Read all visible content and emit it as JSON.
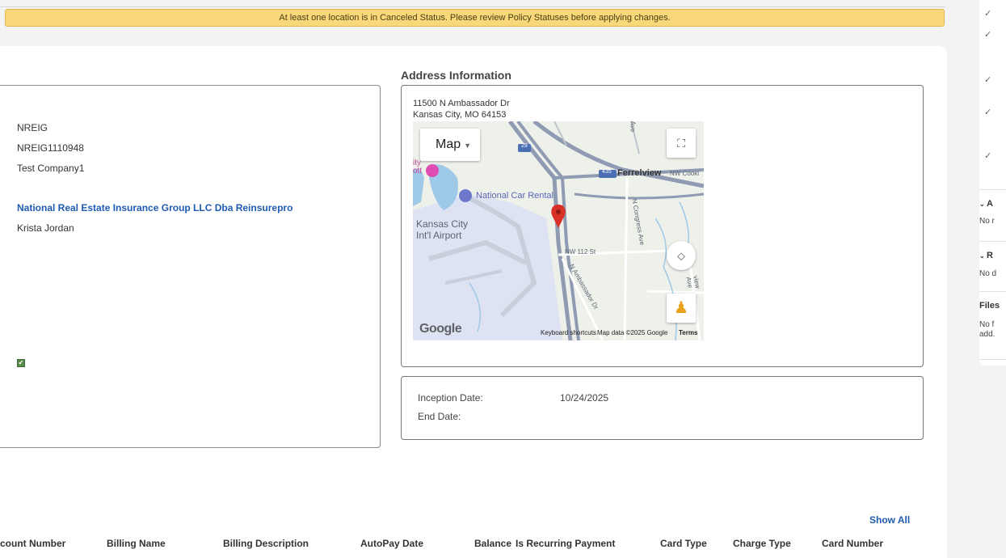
{
  "alert": {
    "message": "At least one location is in Canceled Status. Please review Policy Statuses before applying changes."
  },
  "policy_info": {
    "fields": [
      "NREIG",
      "NREIG1110948",
      "Test Company1"
    ],
    "agency_name": "National Real Estate Insurance Group LLC Dba Reinsurepro",
    "agent_name": "Krista Jordan",
    "checkbox_checked": true
  },
  "address": {
    "title": "Address Information",
    "line1": "11500 N Ambassador Dr",
    "line2": "Kansas City, MO 64153"
  },
  "map": {
    "type_label": "Map",
    "labels": {
      "ferrelview": "Ferrelview",
      "cookingham": "NW Cooki",
      "car_rental": "National Car Rental",
      "airport_1": "Kansas City",
      "airport_2": "Int'l Airport",
      "nw112": "NW 112 St",
      "congress": "N Congress Ave",
      "ambassador": "N Ambassador Dr",
      "hwy29": "29",
      "hwy435": "435",
      "city_partial": "ity",
      "ott_partial": "ott",
      "ave_partial": "Ave",
      "view_ave": "view Ave"
    },
    "logo": "Google",
    "shortcuts": "Keyboard shortcuts",
    "map_data": "Map data ©2025 Google",
    "terms": "Terms",
    "pin_color": "#d93025"
  },
  "dates": {
    "inception_label": "Inception Date:",
    "inception_value": "10/24/2025",
    "end_label": "End Date:",
    "end_value": ""
  },
  "billing": {
    "show_all": "Show All",
    "columns": [
      "count Number",
      "Billing Name",
      "Billing Description",
      "AutoPay Date",
      "Balance",
      "Is Recurring Payment",
      "Card Type",
      "Charge Type",
      "Card Number"
    ]
  },
  "right_panel": {
    "section_a": "A",
    "section_a_text": "No r",
    "section_r": "R",
    "section_r_text": "No d",
    "files_title": "Files",
    "files_text_1": "No f",
    "files_text_2": "add."
  }
}
